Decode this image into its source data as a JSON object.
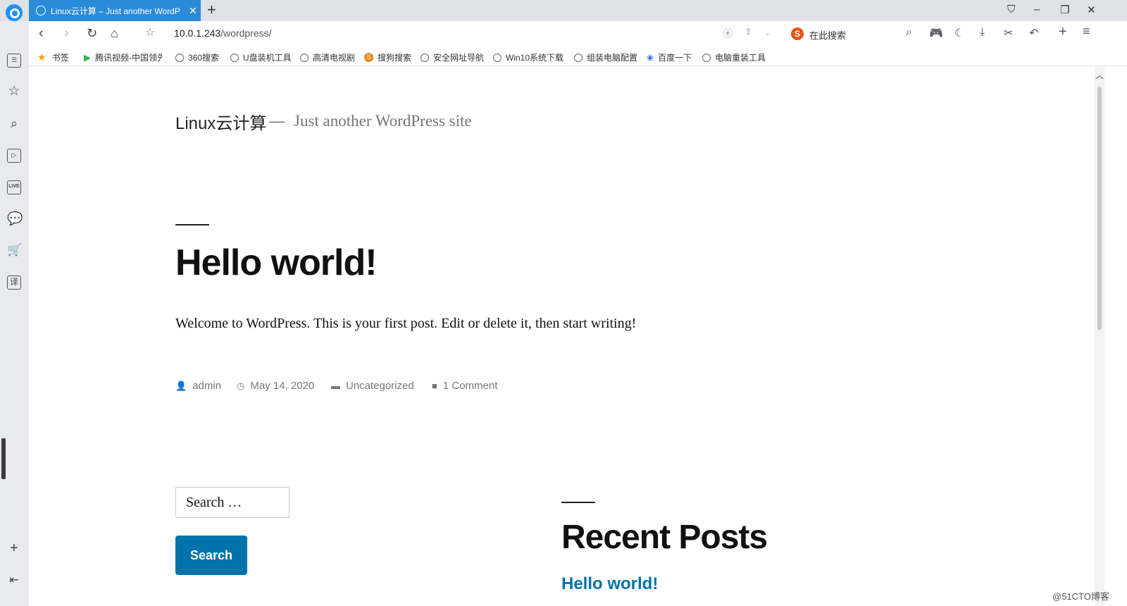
{
  "browser": {
    "tab_title": "Linux云计算 – Just another WordP",
    "tab_close": "✕",
    "new_tab": "+",
    "url_host": "10.0.1.243",
    "url_path": "/wordpress/",
    "search_placeholder": "在此搜索",
    "search_engine_glyph": "S"
  },
  "bookmarks": [
    {
      "label": "书签",
      "icon": "star-icon"
    },
    {
      "label": "腾讯视频-中国领先",
      "icon": "play-icon"
    },
    {
      "label": "360搜索",
      "icon": "globe-icon"
    },
    {
      "label": "U盘装机工具",
      "icon": "globe-icon"
    },
    {
      "label": "高清电视剧",
      "icon": "globe-icon"
    },
    {
      "label": "搜狗搜索",
      "icon": "sogou-icon"
    },
    {
      "label": "安全网址导航",
      "icon": "globe-icon"
    },
    {
      "label": "Win10系统下载",
      "icon": "globe-icon"
    },
    {
      "label": "组装电脑配置",
      "icon": "globe-icon"
    },
    {
      "label": "百度一下",
      "icon": "paw-icon"
    },
    {
      "label": "电脑重装工具",
      "icon": "globe-icon"
    }
  ],
  "sidebar": {
    "live_label": "LIVE",
    "translate_label": "译"
  },
  "site": {
    "title": "Linux云计算",
    "dash": "—",
    "description": "Just another WordPress site"
  },
  "post": {
    "title": "Hello world!",
    "body": "Welcome to WordPress. This is your first post. Edit or delete it, then start writing!",
    "author": "admin",
    "date": "May 14, 2020",
    "category": "Uncategorized",
    "comments": "1 Comment"
  },
  "search_widget": {
    "placeholder": "Search …",
    "button_label": "Search"
  },
  "recent_posts": {
    "title": "Recent Posts",
    "items": [
      "Hello world!"
    ]
  },
  "watermark": "@51CTO博客",
  "colors": {
    "tab_active": "#2a8bd8",
    "link": "#0073aa",
    "button": "#0073aa",
    "meta_text": "#767676"
  }
}
